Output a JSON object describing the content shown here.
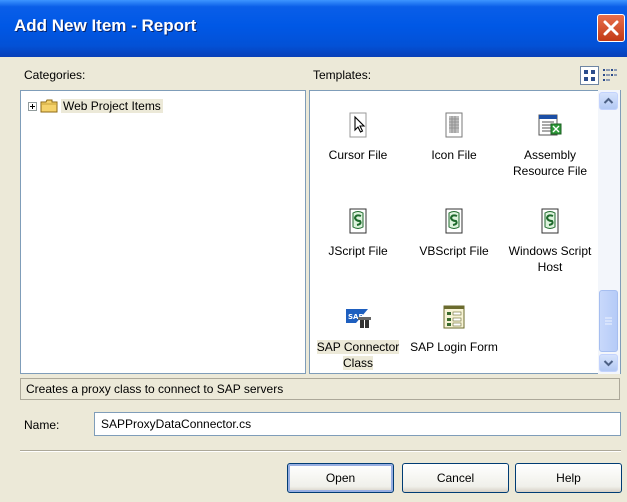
{
  "window": {
    "title": "Add New Item - Report",
    "close_icon": "close-x-icon",
    "close_color": "#C23A16"
  },
  "categories": {
    "label": "Categories:",
    "items": [
      {
        "label": "Web Project Items",
        "icon": "folder-icon",
        "expanded": false
      }
    ]
  },
  "templates": {
    "label": "Templates:",
    "view_modes": [
      {
        "name": "large-icons",
        "icon": "large-icons-view-icon",
        "active": true
      },
      {
        "name": "small-icons",
        "icon": "list-view-icon",
        "active": false
      }
    ],
    "items": [
      {
        "label": "Cursor File",
        "icon": "cursor-file-icon"
      },
      {
        "label": "Icon File",
        "icon": "icon-file-icon"
      },
      {
        "label": "Assembly Resource File",
        "icon": "assembly-resource-file-icon"
      },
      {
        "label": "JScript File",
        "icon": "jscript-file-icon"
      },
      {
        "label": "VBScript File",
        "icon": "vbscript-file-icon"
      },
      {
        "label": "Windows Script Host",
        "icon": "windows-script-host-icon"
      },
      {
        "label": "SAP Connector Class",
        "icon": "sap-connector-icon",
        "selected": true
      },
      {
        "label": "SAP Login Form",
        "icon": "sap-login-form-icon"
      }
    ]
  },
  "description": "Creates a proxy class to connect to SAP servers",
  "name_field": {
    "label": "Name:",
    "value": "SAPProxyDataConnector.cs"
  },
  "buttons": {
    "open": "Open",
    "cancel": "Cancel",
    "help": "Help"
  },
  "colors": {
    "titlebar": "#0058E6",
    "dialog_bg": "#ECE9D8",
    "border": "#7F9DB9"
  }
}
